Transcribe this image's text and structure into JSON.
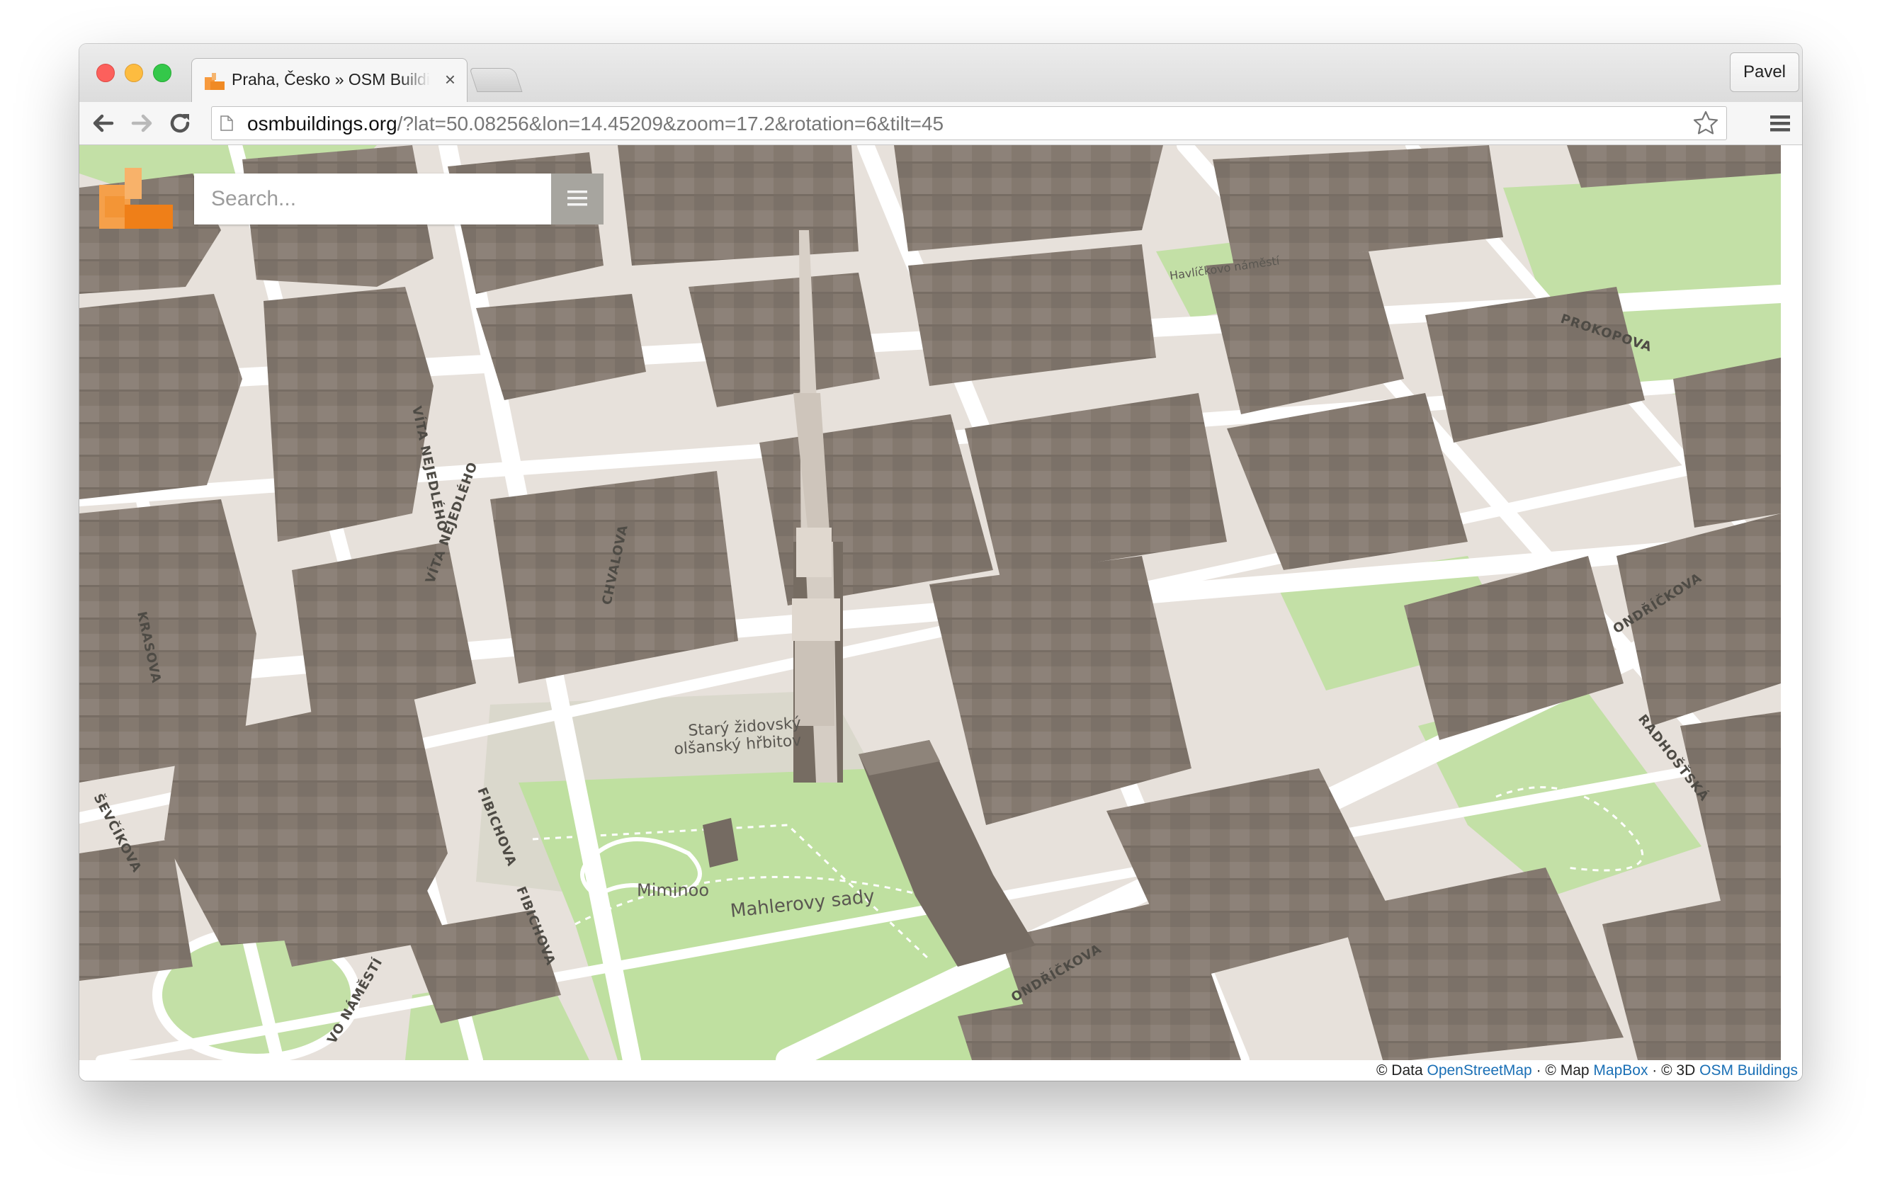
{
  "window": {
    "tab_title": "Praha, Česko » OSM Buildings",
    "tab_close": "×",
    "profile_name": "Pavel"
  },
  "toolbar": {
    "url_host": "osmbuildings.org",
    "url_path": "/?lat=50.08256&lon=14.45209&zoom=17.2&rotation=6&tilt=45",
    "icons": [
      "back-arrow-icon",
      "forward-arrow-icon",
      "reload-icon",
      "page-icon",
      "bookmark-star-icon",
      "chrome-menu-icon"
    ]
  },
  "app": {
    "search_placeholder": "Search...",
    "menu_icon": "☰"
  },
  "map": {
    "place_labels": [
      "Starý židovský",
      "olšanský hřbitov",
      "Miminoo",
      "Mahlerovy sady",
      "Havlíčkovo náměstí"
    ],
    "street_labels": [
      "PROKOPOVA",
      "ONDŘÍČKOVA",
      "RADHOŠŤSKÁ",
      "FIBICHOVA",
      "FIBICHOVA",
      "KRASOVA",
      "ŠEVČÍKOVA",
      "VÍTA NEJEDLÉHO",
      "VÍTA NEJEDLÉHO",
      "CHVALOVA",
      "ONDŘÍČKOVA",
      "VO NÁMĚSTÍ"
    ],
    "colors": {
      "park": "#bfe0a0",
      "ground": "#e6e0da",
      "building": "#857a70",
      "road": "#ffffff"
    }
  },
  "attribution": {
    "data_prefix": "© Data ",
    "data_link": "OpenStreetMap",
    "map_prefix": " · © Map ",
    "map_link": "MapBox",
    "threed_prefix": " · © 3D ",
    "threed_link": "OSM Buildings"
  }
}
